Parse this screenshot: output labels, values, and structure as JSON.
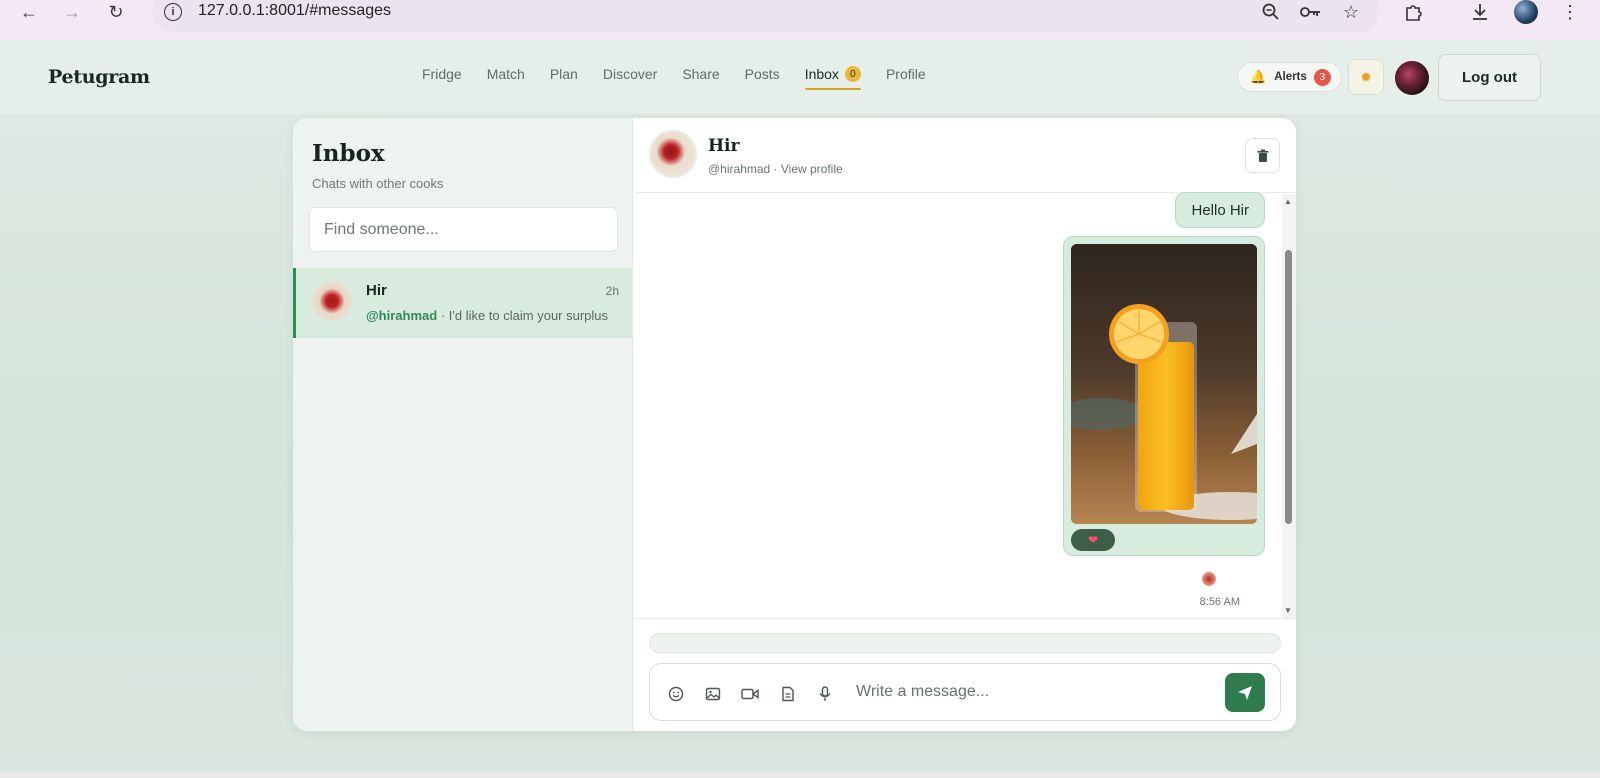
{
  "browser": {
    "url": "127.0.0.1:8001/#messages"
  },
  "header": {
    "brand": "Petugram",
    "nav": [
      {
        "label": "Fridge"
      },
      {
        "label": "Match"
      },
      {
        "label": "Plan"
      },
      {
        "label": "Discover"
      },
      {
        "label": "Share"
      },
      {
        "label": "Posts"
      },
      {
        "label": "Inbox",
        "badge": "0",
        "active": true
      },
      {
        "label": "Profile"
      }
    ],
    "alerts_label": "Alerts",
    "alerts_count": "3",
    "logout_label": "Log out"
  },
  "sidebar": {
    "title": "Inbox",
    "subtitle": "Chats with other cooks",
    "search_placeholder": "Find someone...",
    "conversations": [
      {
        "name": "Hir",
        "time": "2h",
        "handle": "@hirahmad",
        "preview": " · I'd like to claim your surplus",
        "active": true
      }
    ]
  },
  "chat": {
    "name": "Hir",
    "subline": "@hirahmad · View profile",
    "messages": [
      {
        "type": "text",
        "text": "Hello Hir"
      },
      {
        "type": "image",
        "alt": "glass of orange juice",
        "reaction": "heart-icon"
      }
    ],
    "last_time": "8:56 AM",
    "input_placeholder": "Write a message..."
  },
  "colors": {
    "accent_green": "#2f7d4f",
    "nav_underline": "#d9a520",
    "alert_badge": "#e5574a"
  }
}
